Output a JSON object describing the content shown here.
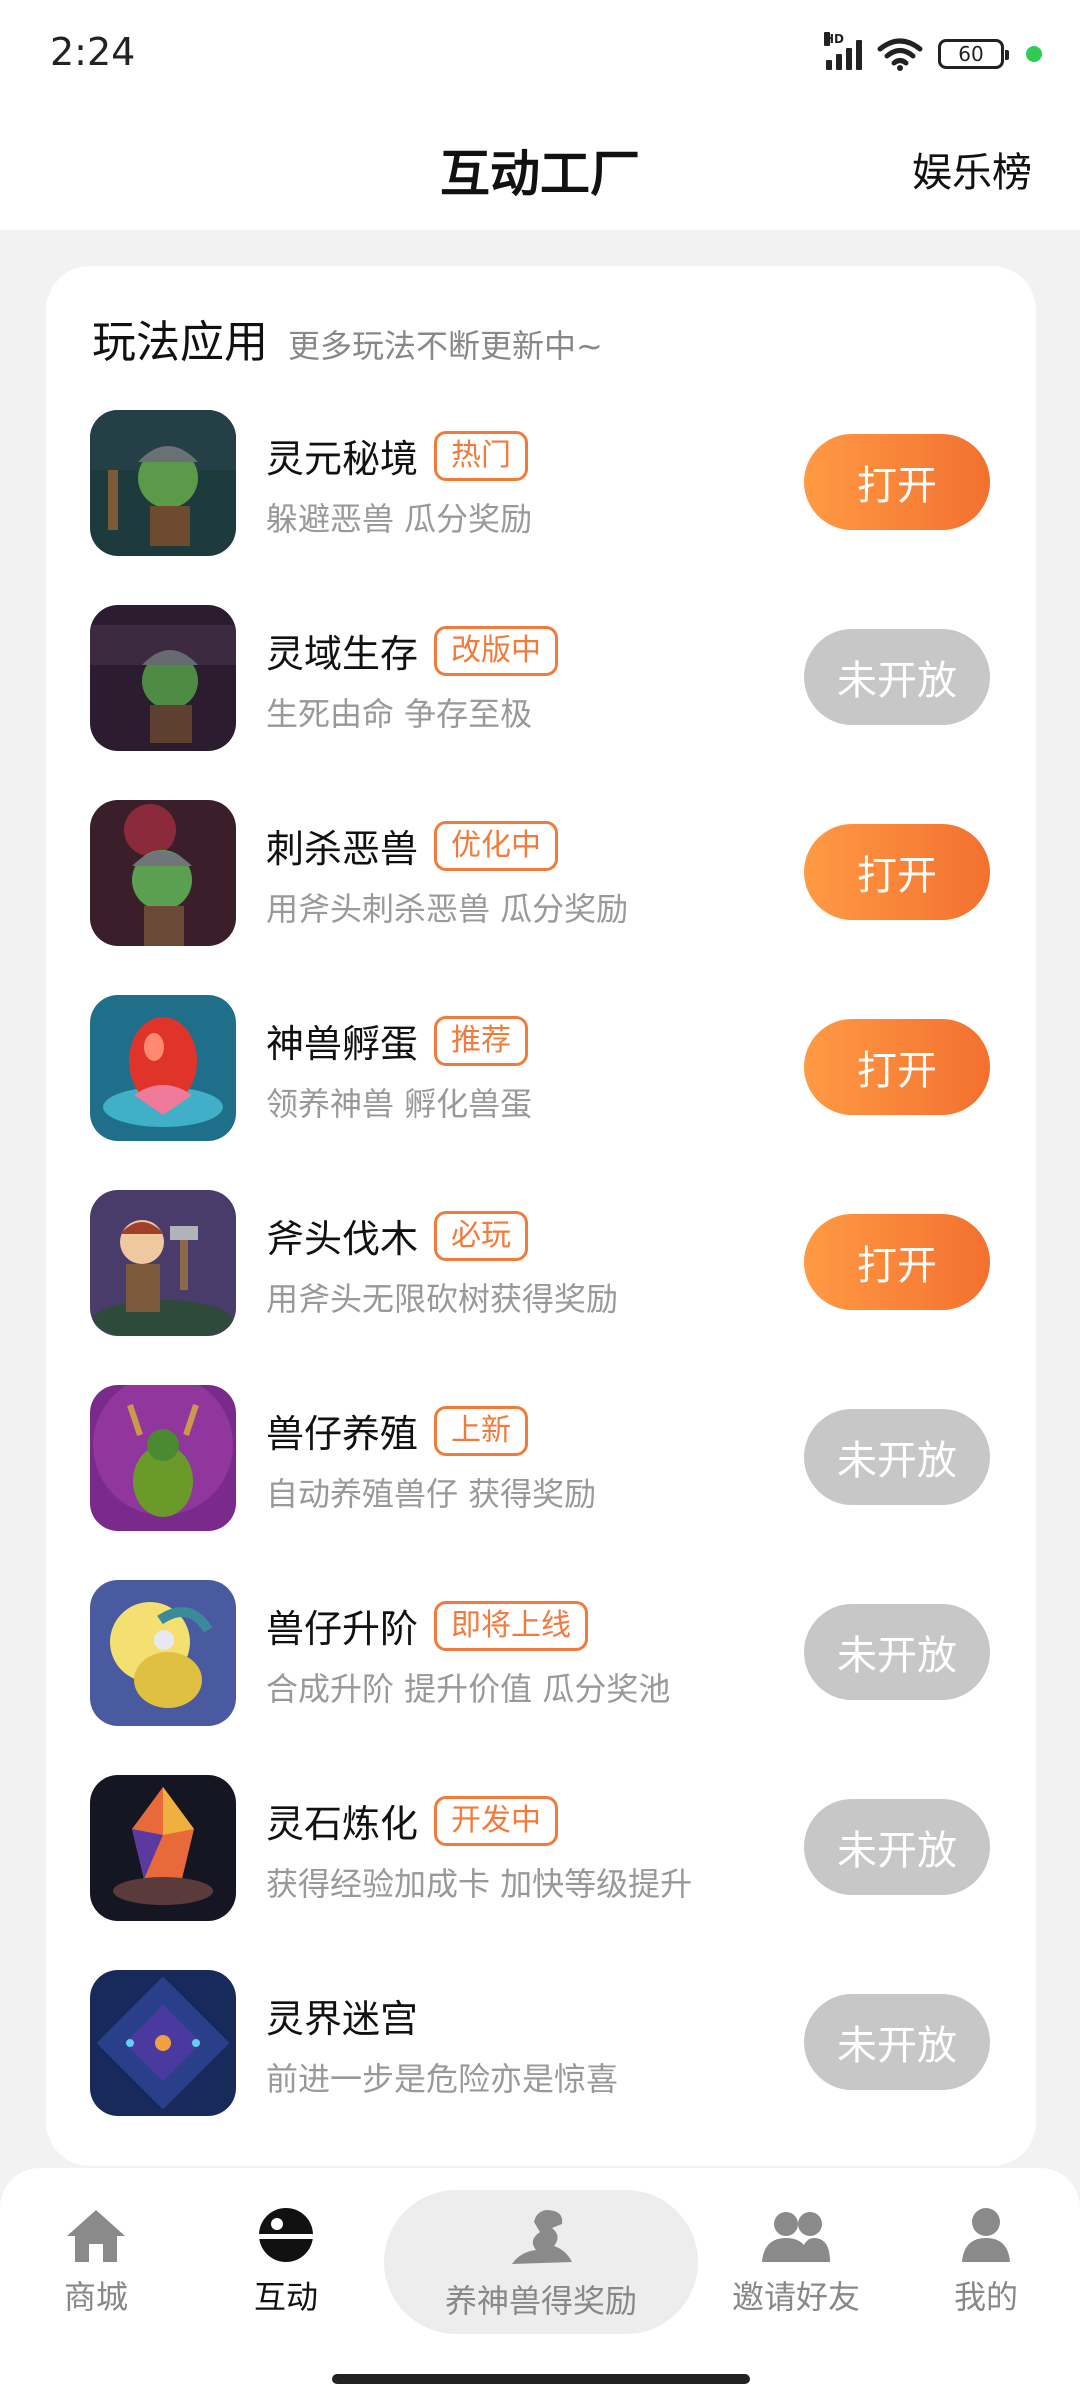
{
  "status_bar": {
    "time": "2:24",
    "battery": "60",
    "hd": "HD"
  },
  "header": {
    "title": "互动工厂",
    "right_link": "娱乐榜"
  },
  "section": {
    "title": "玩法应用",
    "subtitle": "更多玩法不断更新中~"
  },
  "games": [
    {
      "name": "灵元秘境",
      "tag": "热门",
      "desc": "躲避恶兽 瓜分奖励",
      "button": "打开",
      "open": true
    },
    {
      "name": "灵域生存",
      "tag": "改版中",
      "desc": "生死由命 争存至极",
      "button": "未开放",
      "open": false
    },
    {
      "name": "刺杀恶兽",
      "tag": "优化中",
      "desc": "用斧头刺杀恶兽 瓜分奖励",
      "button": "打开",
      "open": true
    },
    {
      "name": "神兽孵蛋",
      "tag": "推荐",
      "desc": "领养神兽 孵化兽蛋",
      "button": "打开",
      "open": true
    },
    {
      "name": "斧头伐木",
      "tag": "必玩",
      "desc": "用斧头无限砍树获得奖励",
      "button": "打开",
      "open": true
    },
    {
      "name": "兽仔养殖",
      "tag": "上新",
      "desc": "自动养殖兽仔 获得奖励",
      "button": "未开放",
      "open": false
    },
    {
      "name": "兽仔升阶",
      "tag": "即将上线",
      "desc": "合成升阶 提升价值 瓜分奖池",
      "button": "未开放",
      "open": false
    },
    {
      "name": "灵石炼化",
      "tag": "开发中",
      "desc": "获得经验加成卡 加快等级提升",
      "button": "未开放",
      "open": false
    },
    {
      "name": "灵界迷宫",
      "tag": "",
      "desc": "前进一步是危险亦是惊喜",
      "button": "未开放",
      "open": false
    }
  ],
  "nav": {
    "shop": "商城",
    "interact": "互动",
    "center": "养神兽得奖励",
    "invite": "邀请好友",
    "mine": "我的"
  }
}
